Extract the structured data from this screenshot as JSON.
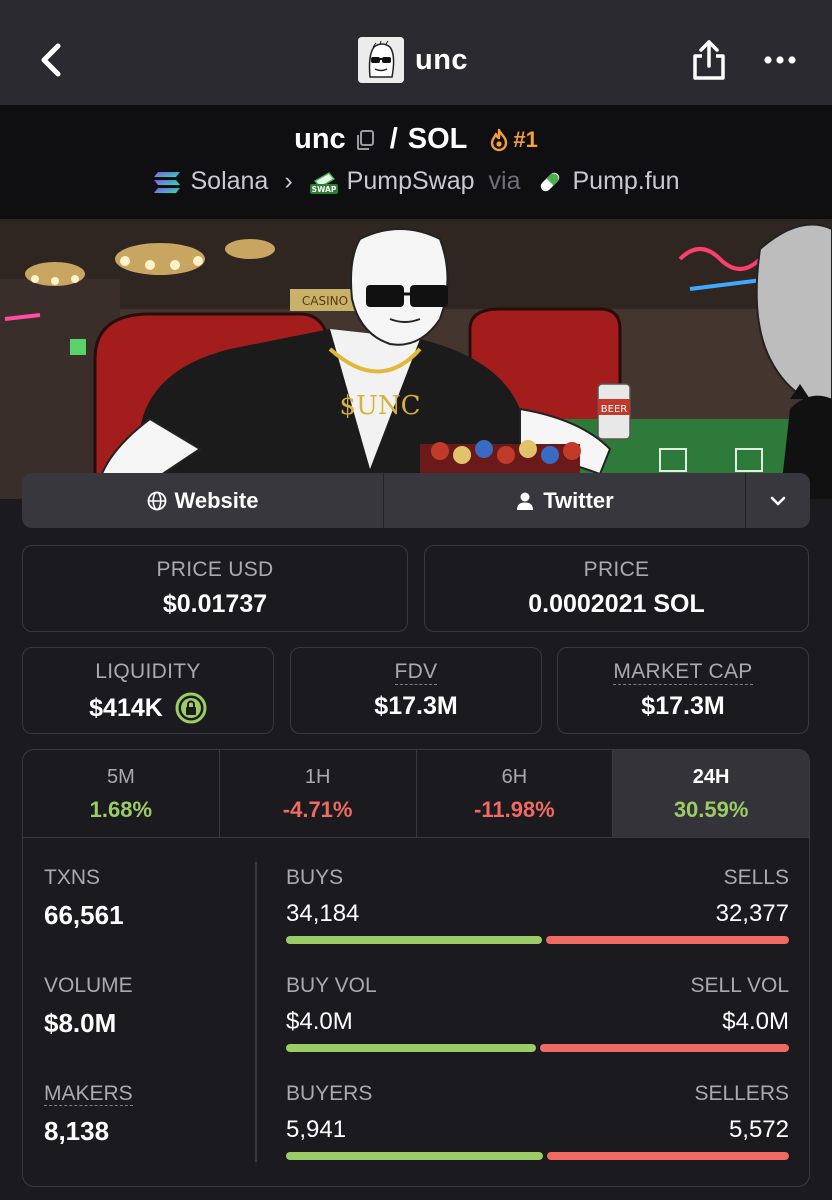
{
  "nav": {
    "title": "unc",
    "avatar_icon": "wojak-sunglasses-avatar",
    "back_icon": "chevron-left-icon",
    "share_icon": "share-icon",
    "more_icon": "more-dots-icon"
  },
  "pair": {
    "base": "unc",
    "quote": "SOL",
    "slash": "/",
    "rank": "#1",
    "chain": "Solana",
    "dex": "PumpSwap",
    "via": "via",
    "launchpad": "Pump.fun",
    "dex_badge": "SWAP"
  },
  "banner": {
    "chips_text": "$UNC",
    "beer_text": "BEER",
    "casino_text": "CASINO"
  },
  "links": {
    "website": "Website",
    "twitter": "Twitter"
  },
  "price_usd": {
    "label": "PRICE USD",
    "value": "$0.01737"
  },
  "price_native": {
    "label": "PRICE",
    "value": "0.0002021 SOL"
  },
  "liquidity": {
    "label": "LIQUIDITY",
    "value": "$414K"
  },
  "fdv": {
    "label": "FDV",
    "value": "$17.3M"
  },
  "market_cap": {
    "label": "MARKET CAP",
    "value": "$17.3M"
  },
  "timeframes": [
    {
      "label": "5M",
      "change": "1.68%",
      "direction": "up"
    },
    {
      "label": "1H",
      "change": "-4.71%",
      "direction": "down"
    },
    {
      "label": "6H",
      "change": "-11.98%",
      "direction": "down"
    },
    {
      "label": "24H",
      "change": "30.59%",
      "direction": "up",
      "active": true
    }
  ],
  "txns": {
    "label": "TXNS",
    "value": "66,561"
  },
  "volume": {
    "label": "VOLUME",
    "value": "$8.0M"
  },
  "makers": {
    "label": "MAKERS",
    "value": "8,138"
  },
  "buys_sells": {
    "buy_label": "BUYS",
    "sell_label": "SELLS",
    "buy_value": "34,184",
    "sell_value": "32,377",
    "buy_fraction": 0.514
  },
  "buy_sell_vol": {
    "buy_label": "BUY VOL",
    "sell_label": "SELL VOL",
    "buy_value": "$4.0M",
    "sell_value": "$4.0M",
    "buy_fraction": 0.5
  },
  "buyers_sellers": {
    "buy_label": "BUYERS",
    "sell_label": "SELLERS",
    "buy_value": "5,941",
    "sell_value": "5,572",
    "buy_fraction": 0.516
  },
  "colors": {
    "positive": "#9ccc65",
    "negative": "#ef6a62",
    "accent_rank": "#f59f3a"
  }
}
